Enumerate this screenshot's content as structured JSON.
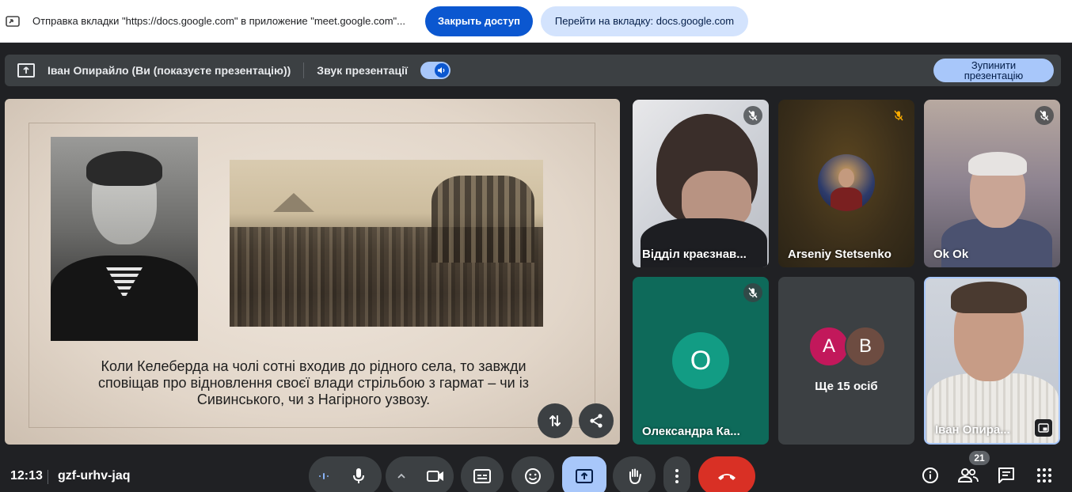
{
  "share_bar": {
    "message": "Отправка вкладки \"https://docs.google.com\" в приложение \"meet.google.com\"...",
    "stop_label": "Закрыть доступ",
    "goto_label": "Перейти на вкладку: docs.google.com"
  },
  "present_bar": {
    "presenter": "Іван Опирайло (Ви (показуєте презентацію))",
    "audio_label": "Звук презентації",
    "audio_on": true,
    "stop_label": "Зупинити презентацію"
  },
  "slide": {
    "text": "Коли Келеберда на чолі сотні входив до рідного села, то завжди сповіщав про відновлення своєї влади стрільбою з гармат – чи із Сивинського, чи з Нагірного узвозу."
  },
  "participants": [
    {
      "name": "Відділ краєзнав...",
      "muted": true
    },
    {
      "name": "Arseniy Stetsenko",
      "muted": true
    },
    {
      "name": "Ok Ok",
      "muted": true
    },
    {
      "name": "Олександра Ка...",
      "initial": "О",
      "muted": true,
      "color": "#129c84"
    },
    {
      "more_label": "Ще 15 осіб",
      "avatars": [
        {
          "letter": "A",
          "color": "#c2185b"
        },
        {
          "letter": "B",
          "color": "#6d4c41"
        }
      ]
    },
    {
      "name": "Іван Опира...",
      "self": true
    }
  ],
  "toolbar": {
    "time": "12:13",
    "meeting_code": "gzf-urhv-jaq",
    "people_count": "21"
  },
  "colors": {
    "accent": "#0b57d0",
    "hangup": "#d93025",
    "active_control": "#a8c7fa"
  }
}
